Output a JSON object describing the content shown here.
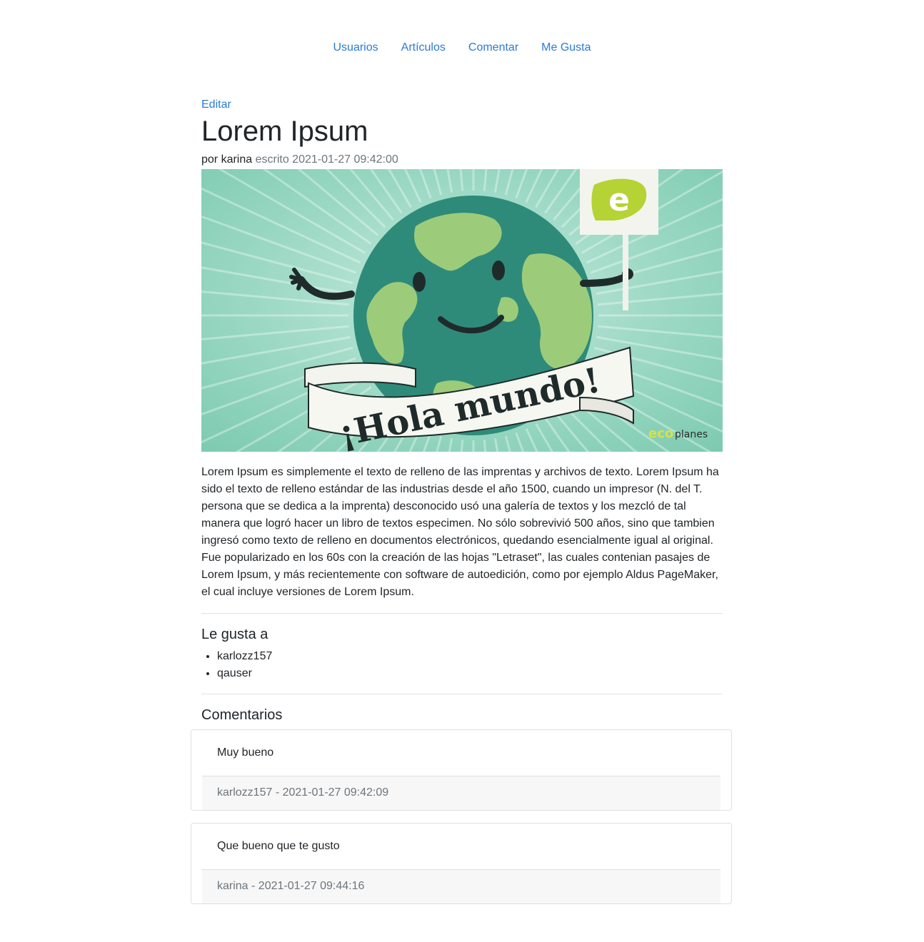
{
  "nav": {
    "items": [
      {
        "label": "Usuarios"
      },
      {
        "label": "Artículos"
      },
      {
        "label": "Comentar"
      },
      {
        "label": "Me Gusta"
      }
    ]
  },
  "article": {
    "edit_label": "Editar",
    "title": "Lorem Ipsum",
    "author_prefix": "por karina",
    "written_label": "escrito 2021-01-27 09:42:00",
    "image": {
      "banner_text": "¡Hola mundo!",
      "sign_letter": "e",
      "logo_text_a": "eco",
      "logo_text_b": "planes"
    },
    "body": "Lorem Ipsum es simplemente el texto de relleno de las imprentas y archivos de texto. Lorem Ipsum ha sido el texto de relleno estándar de las industrias desde el año 1500, cuando un impresor (N. del T. persona que se dedica a la imprenta) desconocido usó una galería de textos y los mezcló de tal manera que logró hacer un libro de textos especimen. No sólo sobrevivió 500 años, sino que tambien ingresó como texto de relleno en documentos electrónicos, quedando esencialmente igual al original. Fue popularizado en los 60s con la creación de las hojas \"Letraset\", las cuales contenian pasajes de Lorem Ipsum, y más recientemente con software de autoedición, como por ejemplo Aldus PageMaker, el cual incluye versiones de Lorem Ipsum."
  },
  "likes": {
    "title": "Le gusta a",
    "users": [
      "karlozz157",
      "qauser"
    ]
  },
  "comments": {
    "title": "Comentarios",
    "items": [
      {
        "text": "Muy bueno",
        "footer": "karlozz157 - 2021-01-27 09:42:09"
      },
      {
        "text": "Que bueno que te gusto",
        "footer": "karina - 2021-01-27 09:44:16"
      }
    ]
  },
  "colors": {
    "link": "#2a7bd4",
    "muted": "#6c757d",
    "image_bg": "#8fd2bd",
    "ocean": "#2e8b7a",
    "land": "#9ccc7a",
    "brand_green": "#b5d334"
  }
}
